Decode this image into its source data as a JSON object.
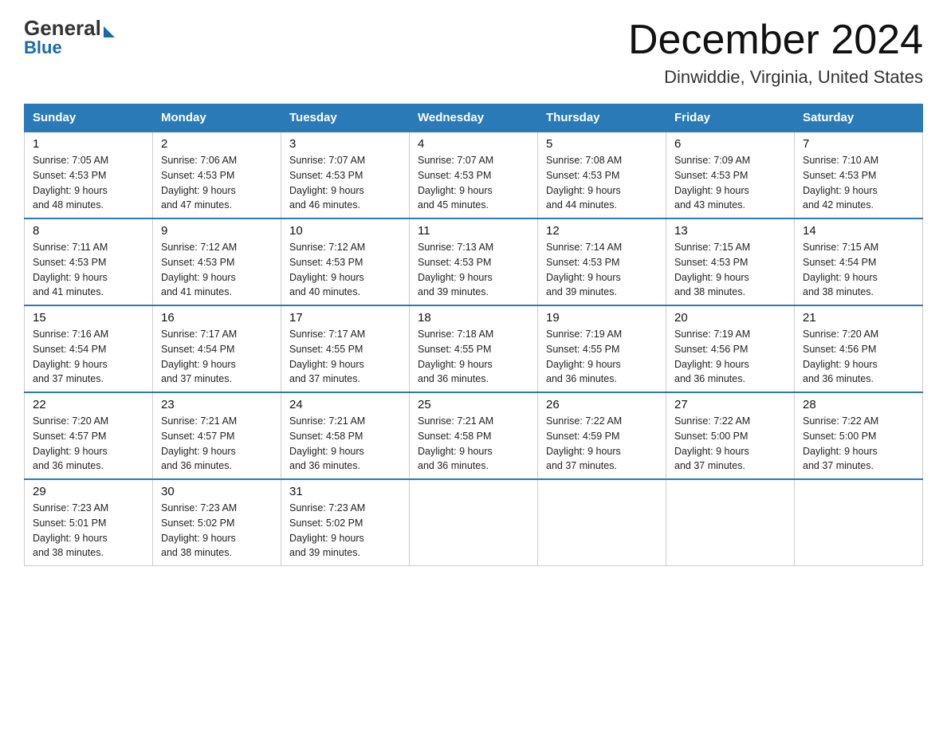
{
  "logo": {
    "general": "General",
    "blue": "Blue"
  },
  "header": {
    "month": "December 2024",
    "location": "Dinwiddie, Virginia, United States"
  },
  "weekdays": [
    "Sunday",
    "Monday",
    "Tuesday",
    "Wednesday",
    "Thursday",
    "Friday",
    "Saturday"
  ],
  "weeks": [
    [
      {
        "day": "1",
        "sunrise": "7:05 AM",
        "sunset": "4:53 PM",
        "daylight": "9 hours and 48 minutes."
      },
      {
        "day": "2",
        "sunrise": "7:06 AM",
        "sunset": "4:53 PM",
        "daylight": "9 hours and 47 minutes."
      },
      {
        "day": "3",
        "sunrise": "7:07 AM",
        "sunset": "4:53 PM",
        "daylight": "9 hours and 46 minutes."
      },
      {
        "day": "4",
        "sunrise": "7:07 AM",
        "sunset": "4:53 PM",
        "daylight": "9 hours and 45 minutes."
      },
      {
        "day": "5",
        "sunrise": "7:08 AM",
        "sunset": "4:53 PM",
        "daylight": "9 hours and 44 minutes."
      },
      {
        "day": "6",
        "sunrise": "7:09 AM",
        "sunset": "4:53 PM",
        "daylight": "9 hours and 43 minutes."
      },
      {
        "day": "7",
        "sunrise": "7:10 AM",
        "sunset": "4:53 PM",
        "daylight": "9 hours and 42 minutes."
      }
    ],
    [
      {
        "day": "8",
        "sunrise": "7:11 AM",
        "sunset": "4:53 PM",
        "daylight": "9 hours and 41 minutes."
      },
      {
        "day": "9",
        "sunrise": "7:12 AM",
        "sunset": "4:53 PM",
        "daylight": "9 hours and 41 minutes."
      },
      {
        "day": "10",
        "sunrise": "7:12 AM",
        "sunset": "4:53 PM",
        "daylight": "9 hours and 40 minutes."
      },
      {
        "day": "11",
        "sunrise": "7:13 AM",
        "sunset": "4:53 PM",
        "daylight": "9 hours and 39 minutes."
      },
      {
        "day": "12",
        "sunrise": "7:14 AM",
        "sunset": "4:53 PM",
        "daylight": "9 hours and 39 minutes."
      },
      {
        "day": "13",
        "sunrise": "7:15 AM",
        "sunset": "4:53 PM",
        "daylight": "9 hours and 38 minutes."
      },
      {
        "day": "14",
        "sunrise": "7:15 AM",
        "sunset": "4:54 PM",
        "daylight": "9 hours and 38 minutes."
      }
    ],
    [
      {
        "day": "15",
        "sunrise": "7:16 AM",
        "sunset": "4:54 PM",
        "daylight": "9 hours and 37 minutes."
      },
      {
        "day": "16",
        "sunrise": "7:17 AM",
        "sunset": "4:54 PM",
        "daylight": "9 hours and 37 minutes."
      },
      {
        "day": "17",
        "sunrise": "7:17 AM",
        "sunset": "4:55 PM",
        "daylight": "9 hours and 37 minutes."
      },
      {
        "day": "18",
        "sunrise": "7:18 AM",
        "sunset": "4:55 PM",
        "daylight": "9 hours and 36 minutes."
      },
      {
        "day": "19",
        "sunrise": "7:19 AM",
        "sunset": "4:55 PM",
        "daylight": "9 hours and 36 minutes."
      },
      {
        "day": "20",
        "sunrise": "7:19 AM",
        "sunset": "4:56 PM",
        "daylight": "9 hours and 36 minutes."
      },
      {
        "day": "21",
        "sunrise": "7:20 AM",
        "sunset": "4:56 PM",
        "daylight": "9 hours and 36 minutes."
      }
    ],
    [
      {
        "day": "22",
        "sunrise": "7:20 AM",
        "sunset": "4:57 PM",
        "daylight": "9 hours and 36 minutes."
      },
      {
        "day": "23",
        "sunrise": "7:21 AM",
        "sunset": "4:57 PM",
        "daylight": "9 hours and 36 minutes."
      },
      {
        "day": "24",
        "sunrise": "7:21 AM",
        "sunset": "4:58 PM",
        "daylight": "9 hours and 36 minutes."
      },
      {
        "day": "25",
        "sunrise": "7:21 AM",
        "sunset": "4:58 PM",
        "daylight": "9 hours and 36 minutes."
      },
      {
        "day": "26",
        "sunrise": "7:22 AM",
        "sunset": "4:59 PM",
        "daylight": "9 hours and 37 minutes."
      },
      {
        "day": "27",
        "sunrise": "7:22 AM",
        "sunset": "5:00 PM",
        "daylight": "9 hours and 37 minutes."
      },
      {
        "day": "28",
        "sunrise": "7:22 AM",
        "sunset": "5:00 PM",
        "daylight": "9 hours and 37 minutes."
      }
    ],
    [
      {
        "day": "29",
        "sunrise": "7:23 AM",
        "sunset": "5:01 PM",
        "daylight": "9 hours and 38 minutes."
      },
      {
        "day": "30",
        "sunrise": "7:23 AM",
        "sunset": "5:02 PM",
        "daylight": "9 hours and 38 minutes."
      },
      {
        "day": "31",
        "sunrise": "7:23 AM",
        "sunset": "5:02 PM",
        "daylight": "9 hours and 39 minutes."
      },
      null,
      null,
      null,
      null
    ]
  ],
  "labels": {
    "sunrise": "Sunrise:",
    "sunset": "Sunset:",
    "daylight": "Daylight:"
  }
}
